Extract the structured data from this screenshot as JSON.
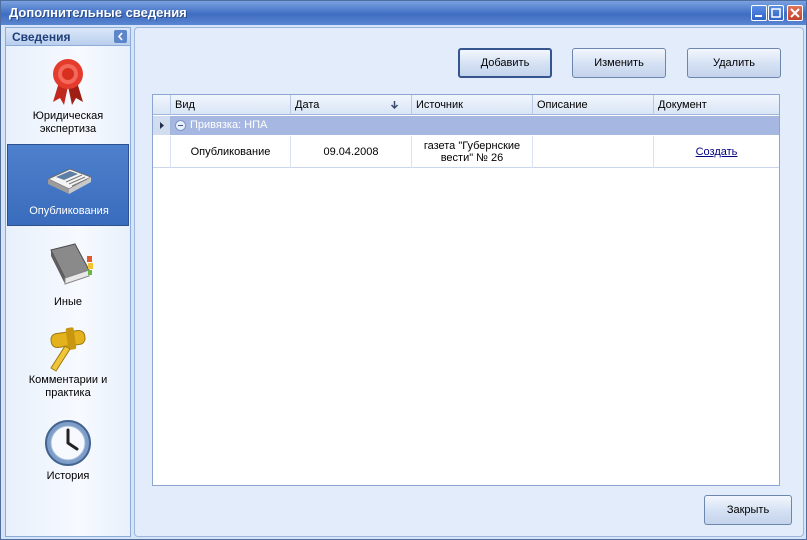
{
  "window": {
    "title": "Дополнительные сведения"
  },
  "sidebar": {
    "header": "Сведения",
    "items": [
      {
        "label": "Юридическая экспертиза",
        "icon": "ribbon-award-icon"
      },
      {
        "label": "Опубликования",
        "icon": "newspaper-icon"
      },
      {
        "label": "Иные",
        "icon": "book-icon"
      },
      {
        "label": "Комментарии и практика",
        "icon": "gavel-icon"
      },
      {
        "label": "История",
        "icon": "clock-icon"
      }
    ]
  },
  "toolbar": {
    "add": "Добавить",
    "edit": "Изменить",
    "delete": "Удалить"
  },
  "grid": {
    "columns": [
      "Вид",
      "Дата",
      "Источник",
      "Описание",
      "Документ"
    ],
    "group": "Привязка: НПА",
    "rows": [
      {
        "vid": "Опубликование",
        "date": "09.04.2008",
        "source": "газета \"Губернские вести\" № 26",
        "description": "",
        "document": "Создать"
      }
    ]
  },
  "footer": {
    "close": "Закрыть"
  },
  "colors": {
    "title_bar": "#4a77c8",
    "active_nav": "#3a6cbd",
    "group_row": "#a6b7e2"
  }
}
